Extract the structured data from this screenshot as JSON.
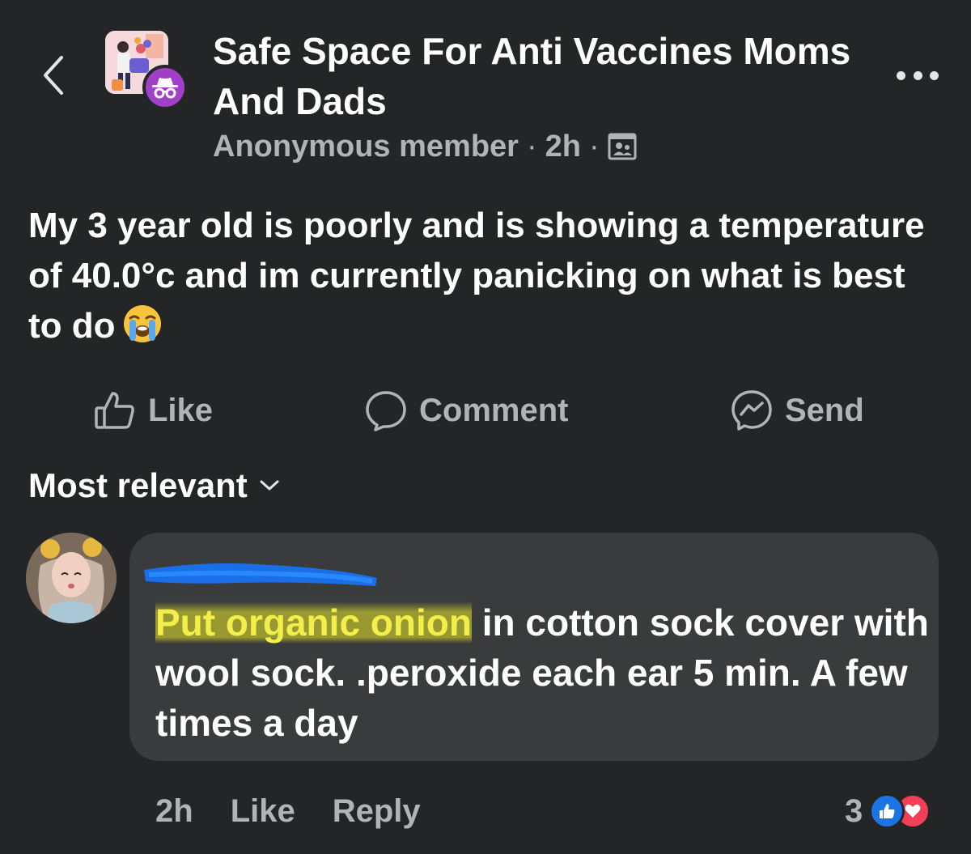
{
  "header": {
    "back_icon": "chevron-left-icon",
    "group_name": "Safe Space For Anti Vaccines Moms And Dads",
    "author": "Anonymous member",
    "time": "2h",
    "separator": "·",
    "audience_icon": "group-members-icon",
    "more_icon": "more-horizontal-icon"
  },
  "post": {
    "text": "My 3 year old is poorly and is showing a temperature of 40.0°c and im currently panicking on what is best to do",
    "emoji": "loudly-crying-face-emoji"
  },
  "actions": {
    "like": "Like",
    "comment": "Comment",
    "send": "Send"
  },
  "sort": {
    "label": "Most relevant"
  },
  "comment": {
    "author_name_redacted": true,
    "text_highlight": "Put organic onion",
    "text_rest": " in cotton sock cover with wool sock. .peroxide each ear 5 min. A few times a day",
    "time": "2h",
    "like_label": "Like",
    "reply_label": "Reply",
    "reaction_count": "3"
  },
  "colors": {
    "background": "#242526",
    "bubble": "#3a3b3c",
    "secondary_text": "#b0b3b8",
    "anon_badge": "#a040c8",
    "like_blue": "#1b74e4",
    "love_red": "#f33e58",
    "highlight": "#e6e628"
  }
}
